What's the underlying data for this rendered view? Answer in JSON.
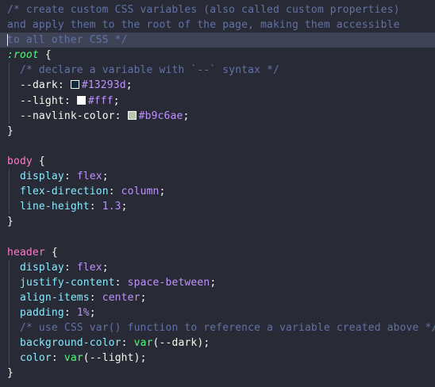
{
  "editor": {
    "colors": {
      "background": "#282a36",
      "comment": "#6272a4",
      "selector": "#ff79c6",
      "property": "#8be9fd",
      "value": "#bd93f9",
      "function": "#50fa7b",
      "text": "#f8f8f2"
    },
    "lines": [
      {
        "selected": false,
        "indent": 0,
        "tokens": [
          {
            "t": "comment",
            "v": "/* create custom CSS variables (also called custom properties)"
          }
        ]
      },
      {
        "selected": false,
        "indent": 0,
        "tokens": [
          {
            "t": "comment",
            "v": "and apply them to the root of the page, making them accessible"
          }
        ]
      },
      {
        "selected": true,
        "cursor": true,
        "indent": 0,
        "tokens": [
          {
            "t": "comment",
            "v": "to all other CSS */"
          }
        ]
      },
      {
        "selected": false,
        "indent": 0,
        "tokens": [
          {
            "t": "pseudo",
            "v": ":root"
          },
          {
            "t": "punct",
            "v": " {"
          }
        ]
      },
      {
        "selected": false,
        "indent": 1,
        "tokens": [
          {
            "t": "comment",
            "v": "/* declare a variable with `--` syntax */"
          }
        ]
      },
      {
        "selected": false,
        "indent": 1,
        "tokens": [
          {
            "t": "var",
            "v": "--dark"
          },
          {
            "t": "punct",
            "v": ": "
          },
          {
            "t": "swatch",
            "color": "#13293d"
          },
          {
            "t": "value",
            "v": "#13293d"
          },
          {
            "t": "punct",
            "v": ";"
          }
        ]
      },
      {
        "selected": false,
        "indent": 1,
        "tokens": [
          {
            "t": "var",
            "v": "--light"
          },
          {
            "t": "punct",
            "v": ": "
          },
          {
            "t": "swatch",
            "color": "#ffffff"
          },
          {
            "t": "value",
            "v": "#fff"
          },
          {
            "t": "punct",
            "v": ";"
          }
        ]
      },
      {
        "selected": false,
        "indent": 1,
        "tokens": [
          {
            "t": "var",
            "v": "--navlink-color"
          },
          {
            "t": "punct",
            "v": ": "
          },
          {
            "t": "swatch",
            "color": "#b9c6ae"
          },
          {
            "t": "value",
            "v": "#b9c6ae"
          },
          {
            "t": "punct",
            "v": ";"
          }
        ]
      },
      {
        "selected": false,
        "indent": 0,
        "tokens": [
          {
            "t": "punct",
            "v": "}"
          }
        ]
      },
      {
        "selected": false,
        "indent": 0,
        "tokens": []
      },
      {
        "selected": false,
        "indent": 0,
        "tokens": [
          {
            "t": "selector",
            "v": "body"
          },
          {
            "t": "punct",
            "v": " {"
          }
        ]
      },
      {
        "selected": false,
        "indent": 1,
        "tokens": [
          {
            "t": "prop",
            "v": "display"
          },
          {
            "t": "punct",
            "v": ": "
          },
          {
            "t": "value",
            "v": "flex"
          },
          {
            "t": "punct",
            "v": ";"
          }
        ]
      },
      {
        "selected": false,
        "indent": 1,
        "tokens": [
          {
            "t": "prop",
            "v": "flex-direction"
          },
          {
            "t": "punct",
            "v": ": "
          },
          {
            "t": "value",
            "v": "column"
          },
          {
            "t": "punct",
            "v": ";"
          }
        ]
      },
      {
        "selected": false,
        "indent": 1,
        "tokens": [
          {
            "t": "prop",
            "v": "line-height"
          },
          {
            "t": "punct",
            "v": ": "
          },
          {
            "t": "value",
            "v": "1.3"
          },
          {
            "t": "punct",
            "v": ";"
          }
        ]
      },
      {
        "selected": false,
        "indent": 0,
        "tokens": [
          {
            "t": "punct",
            "v": "}"
          }
        ]
      },
      {
        "selected": false,
        "indent": 0,
        "tokens": []
      },
      {
        "selected": false,
        "indent": 0,
        "tokens": [
          {
            "t": "selector",
            "v": "header"
          },
          {
            "t": "punct",
            "v": " {"
          }
        ]
      },
      {
        "selected": false,
        "indent": 1,
        "tokens": [
          {
            "t": "prop",
            "v": "display"
          },
          {
            "t": "punct",
            "v": ": "
          },
          {
            "t": "value",
            "v": "flex"
          },
          {
            "t": "punct",
            "v": ";"
          }
        ]
      },
      {
        "selected": false,
        "indent": 1,
        "tokens": [
          {
            "t": "prop",
            "v": "justify-content"
          },
          {
            "t": "punct",
            "v": ": "
          },
          {
            "t": "value",
            "v": "space-between"
          },
          {
            "t": "punct",
            "v": ";"
          }
        ]
      },
      {
        "selected": false,
        "indent": 1,
        "tokens": [
          {
            "t": "prop",
            "v": "align-items"
          },
          {
            "t": "punct",
            "v": ": "
          },
          {
            "t": "value",
            "v": "center"
          },
          {
            "t": "punct",
            "v": ";"
          }
        ]
      },
      {
        "selected": false,
        "indent": 1,
        "tokens": [
          {
            "t": "prop",
            "v": "padding"
          },
          {
            "t": "punct",
            "v": ": "
          },
          {
            "t": "value",
            "v": "1%"
          },
          {
            "t": "punct",
            "v": ";"
          }
        ]
      },
      {
        "selected": false,
        "indent": 1,
        "tokens": [
          {
            "t": "comment",
            "v": "/* use CSS var() function to reference a variable created above */"
          }
        ]
      },
      {
        "selected": false,
        "indent": 1,
        "tokens": [
          {
            "t": "prop",
            "v": "background-color"
          },
          {
            "t": "punct",
            "v": ": "
          },
          {
            "t": "func",
            "v": "var"
          },
          {
            "t": "punct",
            "v": "("
          },
          {
            "t": "var",
            "v": "--dark"
          },
          {
            "t": "punct",
            "v": ");"
          }
        ]
      },
      {
        "selected": false,
        "indent": 1,
        "tokens": [
          {
            "t": "prop",
            "v": "color"
          },
          {
            "t": "punct",
            "v": ": "
          },
          {
            "t": "func",
            "v": "var"
          },
          {
            "t": "punct",
            "v": "("
          },
          {
            "t": "var",
            "v": "--light"
          },
          {
            "t": "punct",
            "v": ");"
          }
        ]
      },
      {
        "selected": false,
        "indent": 0,
        "tokens": [
          {
            "t": "punct",
            "v": "}"
          }
        ]
      }
    ]
  }
}
